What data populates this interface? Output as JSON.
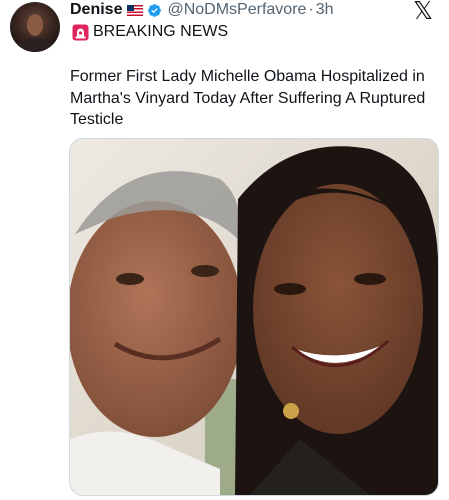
{
  "tweet": {
    "author_name": "Denise",
    "author_handle": "@NoDMsPerfavore",
    "separator": "·",
    "time": "3h",
    "subtitle": "BREAKING NEWS",
    "text": "Former First Lady Michelle Obama Hospitalized in Martha's Vinyard Today After Suffering A Ruptured Testicle",
    "icons": {
      "flag": "us-flag-icon",
      "verified": "verified-badge-icon",
      "siren": "siren-emoji-icon",
      "platform": "x-logo-icon"
    },
    "colors": {
      "verified": "#1d9bf0",
      "handle": "#536471",
      "text": "#0f1419",
      "siren": "#e0245e"
    }
  },
  "platform": {
    "logo_glyph": "𝕏"
  }
}
